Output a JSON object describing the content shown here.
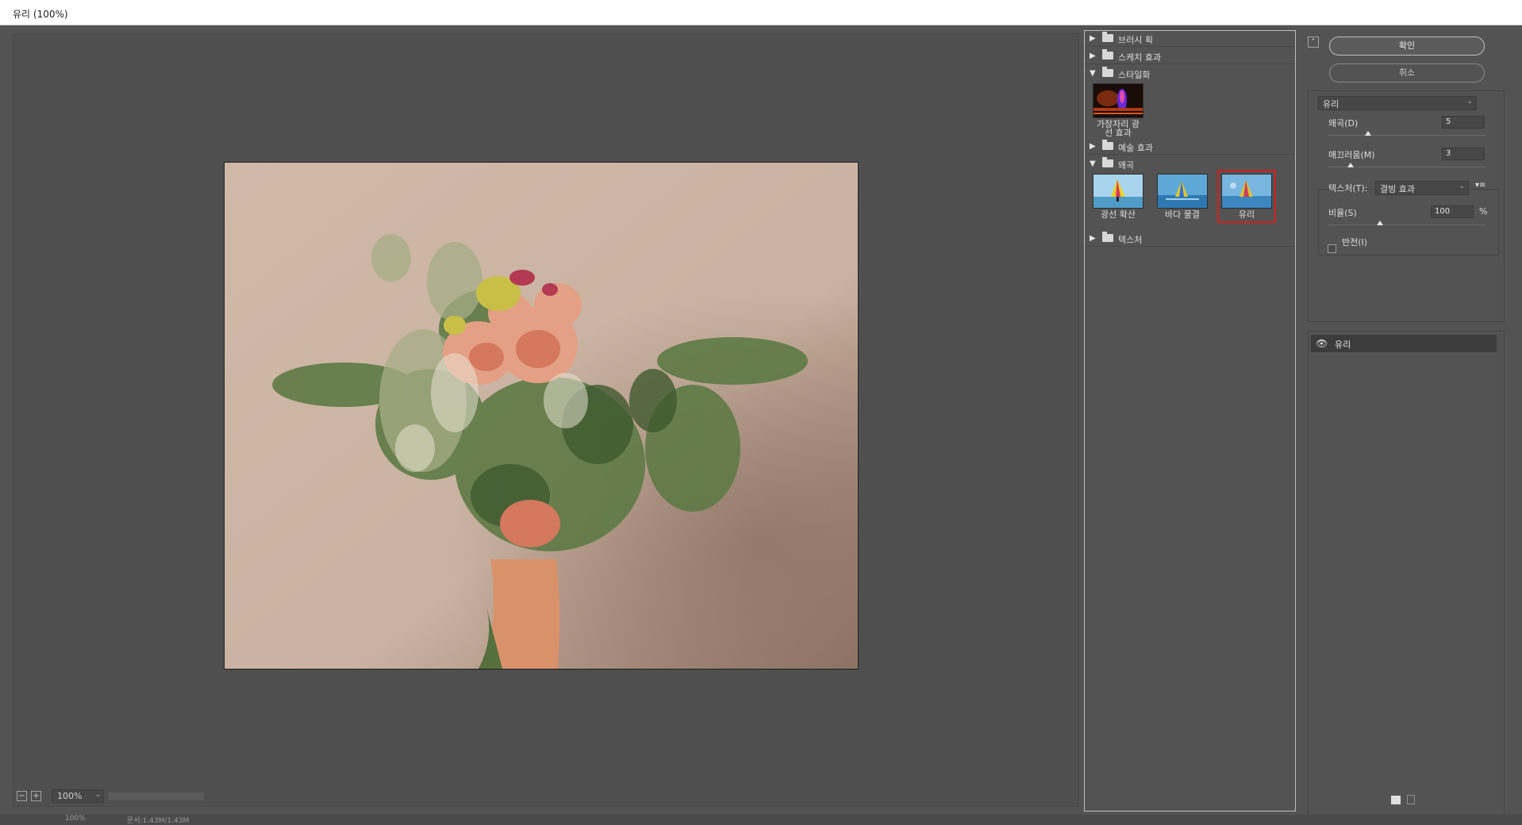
{
  "window": {
    "title": "유리 (100%)"
  },
  "preview": {
    "zoom_value": "100%",
    "zoom_out_label": "−",
    "zoom_in_label": "+"
  },
  "gallery": {
    "folders": [
      {
        "label": "브러시 획",
        "expanded": false
      },
      {
        "label": "스케치 효과",
        "expanded": false
      },
      {
        "label": "스타일화",
        "expanded": true
      },
      {
        "label": "예술 효과",
        "expanded": false
      },
      {
        "label": "왜곡",
        "expanded": true
      },
      {
        "label": "텍스처",
        "expanded": false
      }
    ],
    "stylize_items": [
      {
        "caption": "가장자리 광선 효과"
      }
    ],
    "distort_items": [
      {
        "caption": "광선 확산"
      },
      {
        "caption": "바다 물결"
      },
      {
        "caption": "유리",
        "selected": true
      }
    ]
  },
  "params": {
    "ok_label": "확인",
    "cancel_label": "취소",
    "filter_select": "유리",
    "distortion": {
      "label": "왜곡(D)",
      "value": "5",
      "level": 0.25
    },
    "smoothness": {
      "label": "매끄러움(M)",
      "value": "3",
      "level": 0.14
    },
    "texture": {
      "label": "텍스처(T):",
      "value": "결빙 효과"
    },
    "scaling": {
      "label": "비율(S)",
      "value": "100",
      "unit": "%",
      "level": 0.33
    },
    "invert": {
      "label": "반전(I)",
      "checked": false
    }
  },
  "layers": {
    "items": [
      {
        "name": "유리",
        "visible": true
      }
    ]
  },
  "status": {
    "zoom": "100%",
    "doc_size": "문서:1.43M/1.43M"
  },
  "colors": {
    "selection_outline": "#d21f1f",
    "panel_bg": "#535353",
    "selected_layer": "#3c3c3c"
  }
}
